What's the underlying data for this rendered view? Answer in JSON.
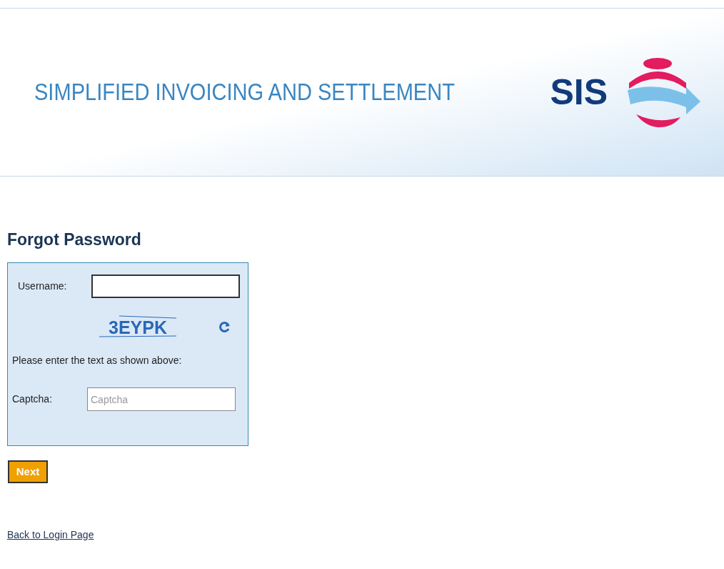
{
  "header": {
    "title": "SIMPLIFIED INVOICING AND SETTLEMENT",
    "logo_text": "SIS"
  },
  "form": {
    "heading": "Forgot Password",
    "username": {
      "label": "Username:"
    },
    "captcha_image": {
      "text": "3EYPK"
    },
    "instruction": "Please enter the text as shown above:",
    "captcha": {
      "label": "Captcha:",
      "placeholder": "Captcha"
    },
    "next_button": "Next"
  },
  "back_link": "Back to Login Page"
}
